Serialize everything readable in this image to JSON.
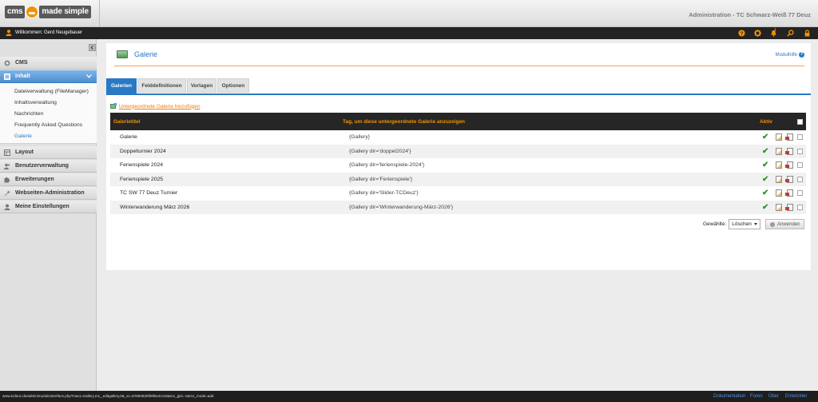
{
  "header": {
    "logo_text_left": "cms",
    "logo_text_right": "made simple",
    "site_title": "Administration - TC Schwarz-Weiß 77 Deuz"
  },
  "userbar": {
    "welcome": "Willkommen: Gerd Neugebauer",
    "notification_count": "1",
    "icons": [
      "help-icon",
      "settings-gear-icon",
      "notification-bell-icon",
      "search-icon",
      "lock-icon"
    ],
    "icon_color": "#f39200"
  },
  "sidebar": {
    "items": [
      {
        "label": "CMS"
      },
      {
        "label": "Inhalt"
      },
      {
        "label": "Layout"
      },
      {
        "label": "Benutzerverwaltung"
      },
      {
        "label": "Erweiterungen"
      },
      {
        "label": "Webseiten-Administration"
      },
      {
        "label": "Meine Einstellungen"
      }
    ],
    "subitems": [
      {
        "label": "Dateiverwaltung (FileManager)"
      },
      {
        "label": "Inhaltsverwaltung"
      },
      {
        "label": "Nachrichten"
      },
      {
        "label": "Frequently Asked Questions"
      },
      {
        "label": "Galerie"
      }
    ]
  },
  "page": {
    "title": "Galerie",
    "help_label": "Modulhilfe",
    "tabs": [
      {
        "label": "Galerien"
      },
      {
        "label": "Felddefinitionen"
      },
      {
        "label": "Vorlagen"
      },
      {
        "label": "Optionen"
      }
    ],
    "add_link": "Untergeordnete Galerie hinzufügen"
  },
  "table": {
    "headers": {
      "title": "Galerietitel",
      "tag": "Tag, um diese untergeordnete Galerie anzuzeigen",
      "active": "Aktiv"
    },
    "rows": [
      {
        "title": "Galerie",
        "tag": "{Gallery}"
      },
      {
        "title": "Doppelturnier 2024",
        "tag": "{Gallery dir='doppel2024'}"
      },
      {
        "title": "Ferienspiele 2024",
        "tag": "{Gallery dir='ferienspiele-2024'}"
      },
      {
        "title": "Ferienspiele 2025",
        "tag": "{Gallery dir='Ferienspiele'}"
      },
      {
        "title": "TC SW 77 Deuz Turnier",
        "tag": "{Gallery dir='Slider-TCDeuz'}"
      },
      {
        "title": "Winterwanderung März 2026",
        "tag": "{Gallery dir='Winterwanderung-März-2026'}"
      }
    ]
  },
  "bulk": {
    "label": "Gewählte:",
    "selected_action": "Löschen",
    "apply_label": "Anwenden"
  },
  "statusbar": {
    "url": "www.tcdeuz.de/admin/moduleinterface.php?mact=Gallery,m1_,editgallery,0&_sc=57692825f08f6e3c118&m1_gid=-1&m1_mode=add",
    "links": [
      {
        "label": "Dokumentation"
      },
      {
        "label": "Foren"
      },
      {
        "label": "Über"
      },
      {
        "label": "Entwickler"
      }
    ]
  },
  "colors": {
    "accent": "#2a79c4",
    "brand_orange": "#f39200"
  }
}
